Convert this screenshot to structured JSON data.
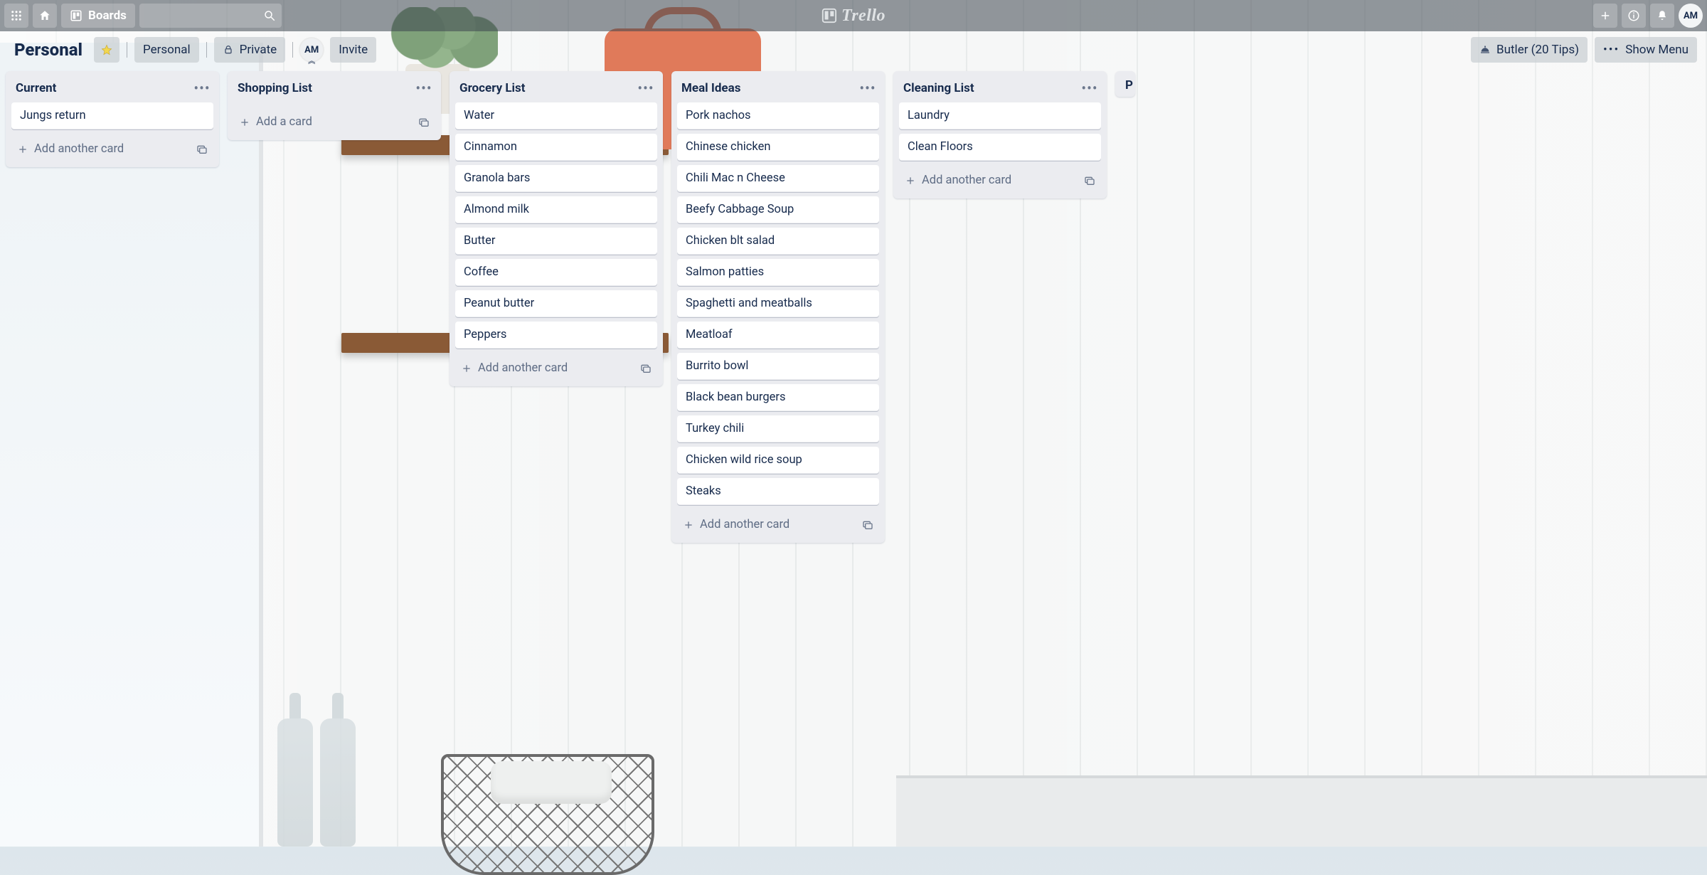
{
  "app": {
    "name": "Trello",
    "boards_button": "Boards"
  },
  "user": {
    "initials": "AM"
  },
  "board": {
    "title": "Personal",
    "team": "Personal",
    "visibility": "Private",
    "invite_label": "Invite",
    "butler_label": "Butler (20 Tips)",
    "show_menu_label": "Show Menu"
  },
  "labels": {
    "add_card": "Add a card",
    "add_another_card": "Add another card"
  },
  "lists": [
    {
      "title": "Current",
      "footer": "add_another_card",
      "cards": [
        "Jungs return"
      ]
    },
    {
      "title": "Shopping List",
      "footer": "add_card",
      "cards": []
    },
    {
      "title": "Grocery List",
      "footer": "add_another_card",
      "cards": [
        "Water",
        "Cinnamon",
        "Granola bars",
        "Almond milk",
        "Butter",
        "Coffee",
        "Peanut butter",
        "Peppers"
      ]
    },
    {
      "title": "Meal Ideas",
      "footer": "add_another_card",
      "cards": [
        "Pork nachos",
        "Chinese chicken",
        "Chili Mac n Cheese",
        "Beefy Cabbage Soup",
        "Chicken blt salad",
        "Salmon patties",
        "Spaghetti and meatballs",
        "Meatloaf",
        "Burrito bowl",
        "Black bean burgers",
        "Turkey chili",
        "Chicken wild rice soup",
        "Steaks"
      ]
    },
    {
      "title": "Cleaning List",
      "footer": "add_another_card",
      "cards": [
        "Laundry",
        "Clean Floors"
      ]
    }
  ],
  "peek_list_initial": "P"
}
